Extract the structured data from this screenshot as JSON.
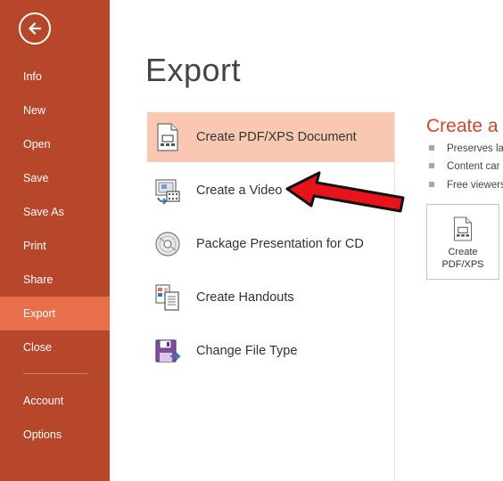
{
  "sidebar": {
    "back_icon": "back-arrow-icon",
    "items": [
      {
        "label": "Info"
      },
      {
        "label": "New"
      },
      {
        "label": "Open"
      },
      {
        "label": "Save"
      },
      {
        "label": "Save As"
      },
      {
        "label": "Print"
      },
      {
        "label": "Share"
      },
      {
        "label": "Export",
        "active": true
      },
      {
        "label": "Close"
      },
      {
        "label": "Account"
      },
      {
        "label": "Options"
      }
    ]
  },
  "main": {
    "title": "Export",
    "options": [
      {
        "label": "Create PDF/XPS Document",
        "icon": "pdf-document-icon",
        "selected": true
      },
      {
        "label": "Create a Video",
        "icon": "video-icon"
      },
      {
        "label": "Package Presentation for CD",
        "icon": "cd-icon"
      },
      {
        "label": "Create Handouts",
        "icon": "handouts-icon"
      },
      {
        "label": "Change File Type",
        "icon": "save-file-type-icon"
      }
    ]
  },
  "right_panel": {
    "title": "Create a P",
    "bullets": [
      "Preserves la",
      "Content car",
      "Free viewers"
    ],
    "button": {
      "line1": "Create",
      "line2": "PDF/XPS",
      "icon": "pdf-document-icon"
    }
  },
  "annotation": {
    "icon": "red-arrow-pointer"
  },
  "colors": {
    "sidebar_bg": "#b7472a",
    "sidebar_active": "#e96e4c",
    "selected_option_bg": "#f8c8b3",
    "accent_title": "#d24726",
    "arrow": "#e8131b"
  }
}
